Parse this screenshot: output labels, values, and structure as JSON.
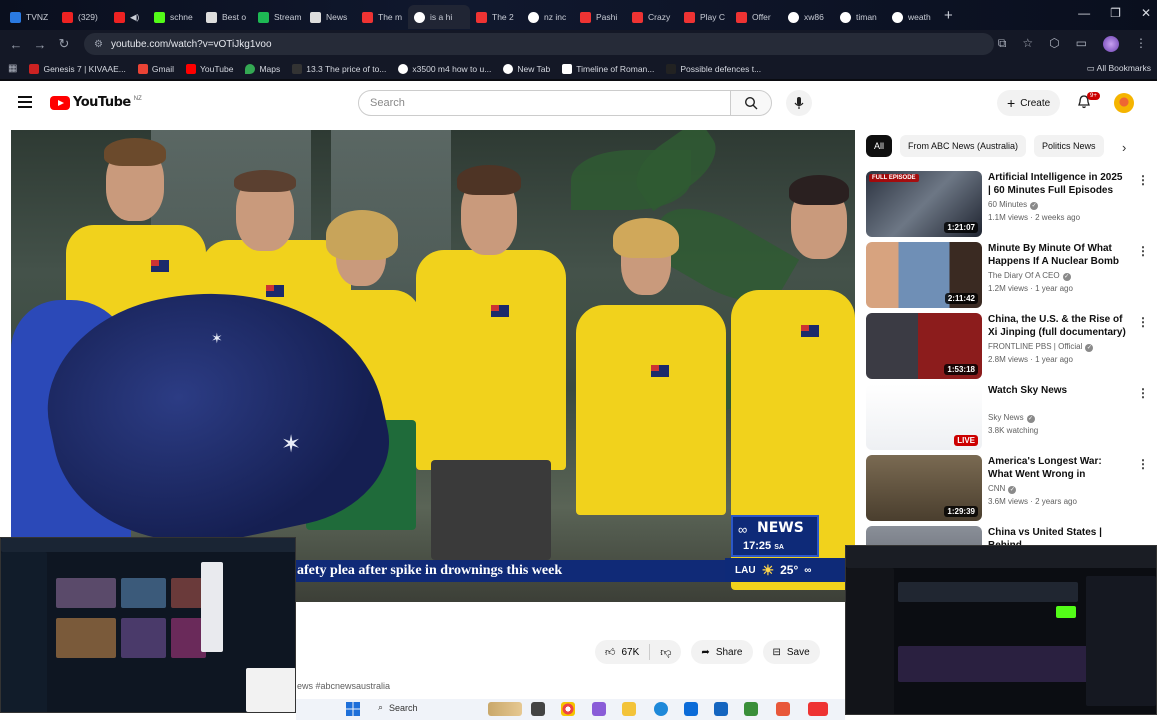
{
  "browser": {
    "tabs": [
      "TVNZ",
      "(329)",
      "",
      "schne",
      "Best o",
      "Stream",
      "News",
      "The m",
      "is a hi",
      "The 2",
      "nz inc",
      "Pashi",
      "Crazy",
      "Play C",
      "Offer",
      "xw86",
      "timan",
      "weath"
    ],
    "url": "youtube.com/watch?v=vOTiJkg1voo",
    "bookmarks": [
      "Genesis 7 | KIVAAE...",
      "Gmail",
      "YouTube",
      "Maps",
      "13.3 The price of to...",
      "x3500 m4 how to u...",
      "New Tab",
      "Timeline of Roman...",
      "Possible defences t..."
    ],
    "all_bookmarks": "All Bookmarks"
  },
  "youtube": {
    "logo_text": "YouTube",
    "region": "NZ",
    "search_placeholder": "Search",
    "create_label": "Create",
    "notification_count": "9+",
    "chips": [
      "All",
      "From ABC News (Australia)",
      "Politics News"
    ],
    "video": {
      "ticker": "afety plea after spike in drownings this week",
      "abc_title": "NEWS",
      "abc_time": "17:25",
      "abc_tz": "SA",
      "weather_place": "LAU",
      "weather_temp": "25°"
    },
    "actions": {
      "likes": "67K",
      "share": "Share",
      "save": "Save"
    },
    "hashtags": "ews #abcnewsaustralia",
    "recommendations": [
      {
        "title": "Artificial Intelligence in 2025 | 60 Minutes Full Episodes",
        "channel": "60 Minutes",
        "meta": "1.1M views · 2 weeks ago",
        "duration": "1:21:07",
        "label": "FULL EPISODE"
      },
      {
        "title": "Minute By Minute Of What Happens If A Nuclear Bomb ...",
        "channel": "The Diary Of A CEO",
        "meta": "1.2M views · 1 year ago",
        "duration": "2:11:42",
        "label": ""
      },
      {
        "title": "China, the U.S. & the Rise of Xi Jinping (full documentary) | ...",
        "channel": "FRONTLINE PBS | Official",
        "meta": "2.8M views · 1 year ago",
        "duration": "1:53:18",
        "label": ""
      },
      {
        "title": "Watch Sky News",
        "channel": "Sky News",
        "meta": "3.8K watching",
        "duration": "LIVE",
        "label": ""
      },
      {
        "title": "America's Longest War: What Went Wrong in Afghanistan ...",
        "channel": "CNN",
        "meta": "3.6M views · 2 years ago",
        "duration": "1:29:39",
        "label": ""
      },
      {
        "title": "China vs United States | Behind",
        "channel": "",
        "meta": "",
        "duration": "",
        "label": ""
      }
    ]
  },
  "taskbar": {
    "search": "Search"
  },
  "colors": {
    "yt_red": "#ff0000",
    "abc_blue": "#0e2a78",
    "shirt_yellow": "#f1d21c"
  }
}
